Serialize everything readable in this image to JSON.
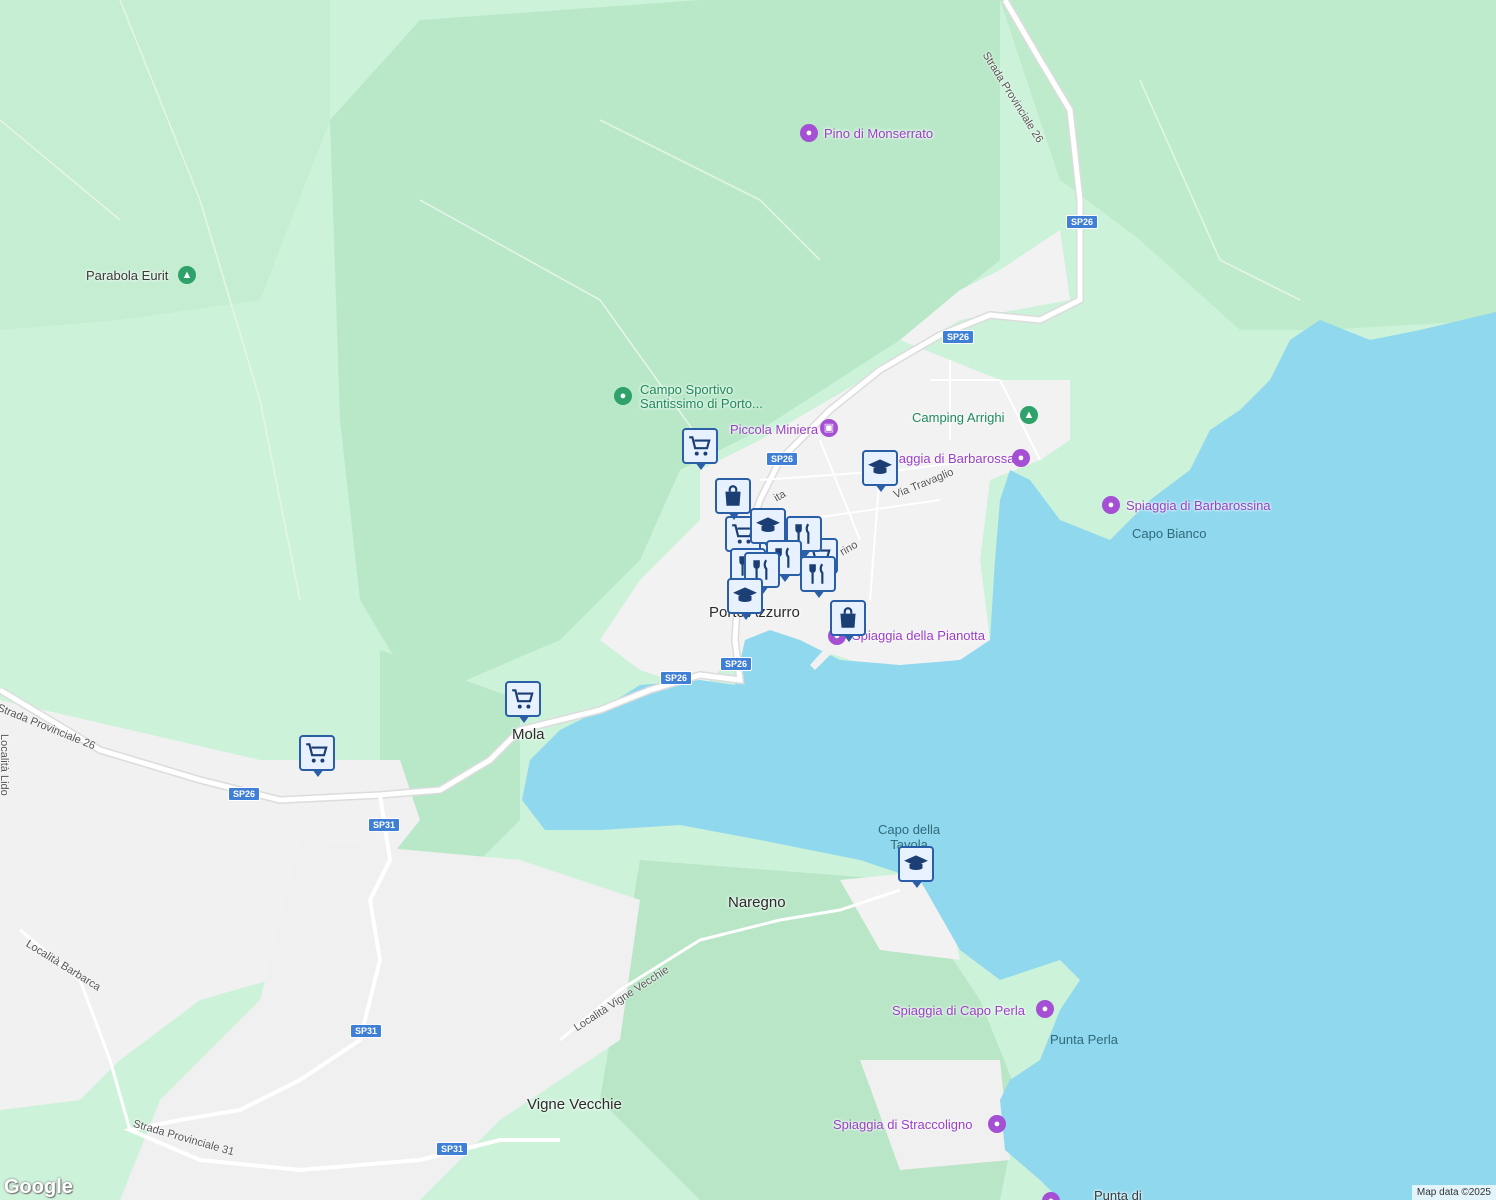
{
  "map": {
    "places": {
      "porto_azzurro": "Porto Azzurro",
      "mola": "Mola",
      "naregno": "Naregno",
      "vigne_vecchie": "Vigne Vecchie"
    },
    "pois": {
      "pino_di_monserrato": "Pino di Monserrato",
      "parabola_eurit": "Parabola Eurit",
      "campo_sportivo": "Campo Sportivo\nSantissimo di Porto...",
      "piccola_miniera": "Piccola Miniera",
      "camping_arrighi": "Camping Arrighi",
      "spiaggia_barbarossa": "Spiaggia di Barbarossa",
      "spiaggia_barbarossina": "Spiaggia di Barbarossina",
      "spiaggia_pianotta": "Spiaggia della Pianotta",
      "spiaggia_capo_perla": "Spiaggia di Capo Perla",
      "spiaggia_straccoligno": "Spiaggia di Straccoligno",
      "punta_di": "Punta di"
    },
    "coast_labels": {
      "capo_bianco": "Capo Bianco",
      "capo_della_tavola": "Capo della\nTavola",
      "punta_perla": "Punta Perla"
    },
    "streets": {
      "sp26_north": "Strada Provinciale 26",
      "sp26_west": "Strada Provinciale 26",
      "sp31": "Strada Provinciale 31",
      "via_travaglio": "Via Travaglio",
      "localita_vigne_vecchie": "Località Vigne Vecchie",
      "localita_barbarca": "Località Barbarca",
      "localita_lido": "Località Lido",
      "via_marino": "rino",
      "via_ita": "ita"
    },
    "shields": {
      "sp26": "SP26",
      "sp31": "SP31"
    },
    "marker_icons": [
      "shopping-cart-icon",
      "shopping-bag-icon",
      "restaurant-icon",
      "school-icon"
    ],
    "colors": {
      "sea": "#8fd8ee",
      "land": "#c9f0d8",
      "forest": "#b8e9c8",
      "urban": "#f3f3f3",
      "marker_border": "#2a5fa8",
      "poi_purple": "#a44fd4",
      "poi_green": "#2ea26a"
    },
    "logo": "Google",
    "attribution": "Map data ©2025"
  }
}
